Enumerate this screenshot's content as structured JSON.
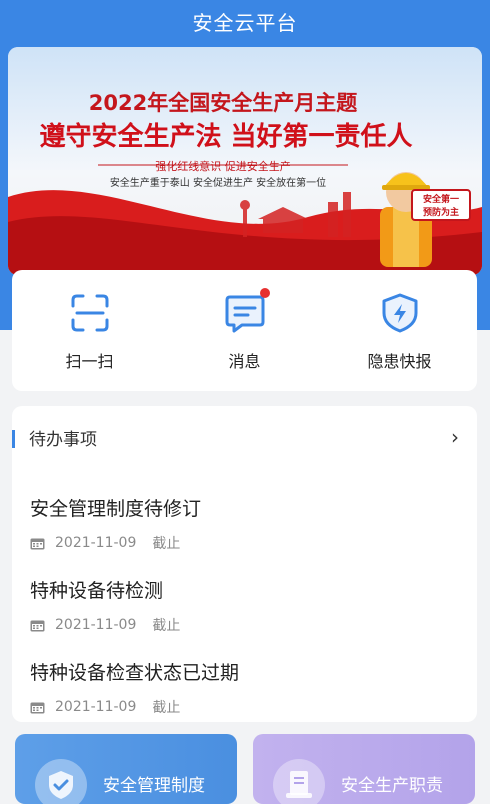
{
  "app": {
    "title": "安全云平台"
  },
  "banner": {
    "heading": "2022年全国安全生产月主题",
    "slogan": "遵守安全生产法 当好第一责任人",
    "sub": "强化红线意识  促进安全生产",
    "line": "安全生产重于泰山 安全促进生产 安全放在第一位",
    "badge_line1": "安全第一",
    "badge_line2": "预防为主"
  },
  "quick": [
    {
      "label": "扫一扫",
      "icon": "scan-icon"
    },
    {
      "label": "消息",
      "icon": "message-icon",
      "has_dot": true
    },
    {
      "label": "隐患快报",
      "icon": "shield-bolt-icon"
    }
  ],
  "todo": {
    "title": "待办事项",
    "more": "›",
    "items": [
      {
        "name": "安全管理制度待修订",
        "date": "2021-11-09",
        "deadline": "截止"
      },
      {
        "name": "特种设备待检测",
        "date": "2021-11-09",
        "deadline": "截止"
      },
      {
        "name": "特种设备检查状态已过期",
        "date": "2021-11-09",
        "deadline": "截止"
      }
    ]
  },
  "cards": [
    {
      "label": "安全管理制度",
      "icon": "shield-check-icon"
    },
    {
      "label": "安全生产职责",
      "icon": "document-icon"
    }
  ]
}
